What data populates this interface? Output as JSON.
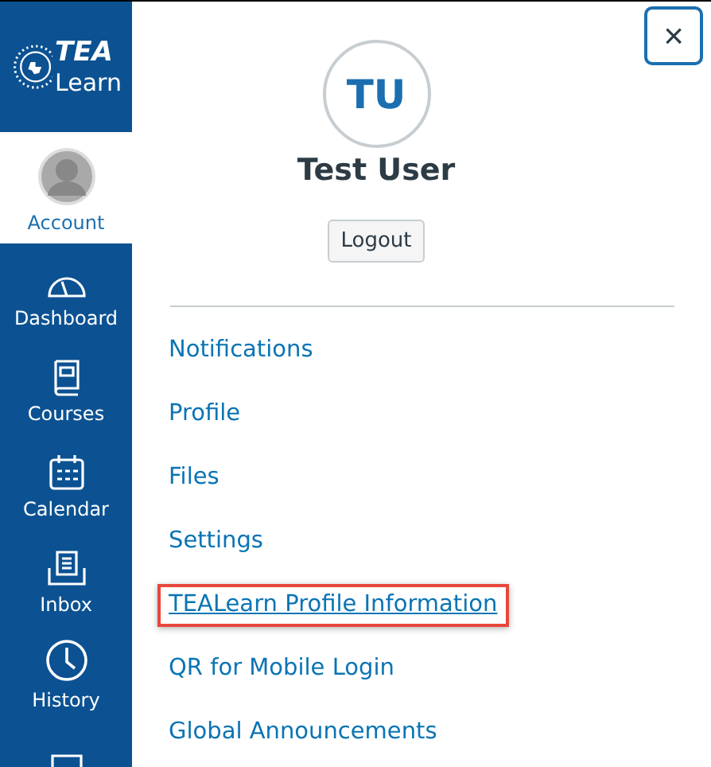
{
  "logo": {
    "line_1": "TEA",
    "line_2": "Learn"
  },
  "sidebar": {
    "items": [
      {
        "kind": "account",
        "label": "Account",
        "selected": true
      },
      {
        "kind": "dashboard",
        "label": "Dashboard",
        "selected": false
      },
      {
        "kind": "courses",
        "label": "Courses",
        "selected": false
      },
      {
        "kind": "calendar",
        "label": "Calendar",
        "selected": false
      },
      {
        "kind": "inbox",
        "label": "Inbox",
        "selected": false
      },
      {
        "kind": "history",
        "label": "History",
        "selected": false
      },
      {
        "kind": "more",
        "selected": false
      }
    ]
  },
  "panel": {
    "close": "×",
    "initials": "TU",
    "name": "Test User",
    "logout": "Logout",
    "links": [
      {
        "label": "Notifications",
        "highlighted": false
      },
      {
        "label": "Profile",
        "highlighted": false
      },
      {
        "label": "Files",
        "highlighted": false
      },
      {
        "label": "Settings",
        "highlighted": false
      },
      {
        "label": "TEALearn Profile Information",
        "highlighted": true
      },
      {
        "label": "QR for Mobile Login",
        "highlighted": false
      },
      {
        "label": "Global Announcements",
        "highlighted": false
      }
    ]
  }
}
